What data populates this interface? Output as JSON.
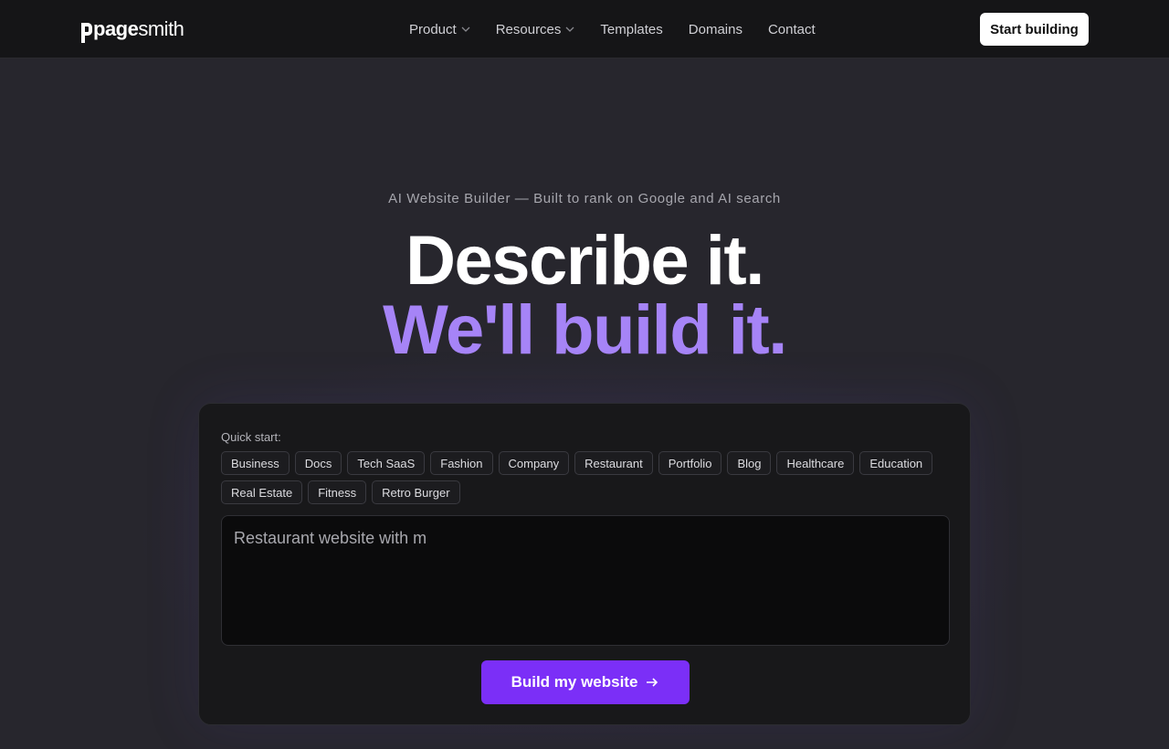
{
  "brand": {
    "bold": "page",
    "light": "smith"
  },
  "nav": {
    "items": [
      {
        "label": "Product",
        "dropdown": true
      },
      {
        "label": "Resources",
        "dropdown": true
      },
      {
        "label": "Templates",
        "dropdown": false
      },
      {
        "label": "Domains",
        "dropdown": false
      },
      {
        "label": "Contact",
        "dropdown": false
      }
    ],
    "cta_label": "Start building"
  },
  "hero": {
    "eyebrow": "AI Website Builder — Built to rank on Google and AI search",
    "headline_1": "Describe it.",
    "headline_2": "We'll build it.",
    "accent_color": "#a684f7"
  },
  "builder": {
    "quick_start_label": "Quick start:",
    "chips": [
      "Business",
      "Docs",
      "Tech SaaS",
      "Fashion",
      "Company",
      "Restaurant",
      "Portfolio",
      "Blog",
      "Healthcare",
      "Education",
      "Real Estate",
      "Fitness",
      "Retro Burger"
    ],
    "prompt_value": "Restaurant website with m",
    "build_label": "Build my website",
    "button_color": "#7b2ff7"
  },
  "icons": {
    "dropdown": "chevron-down-icon",
    "build_arrow": "arrow-right-icon",
    "logo": "pagesmith-logo-icon"
  }
}
